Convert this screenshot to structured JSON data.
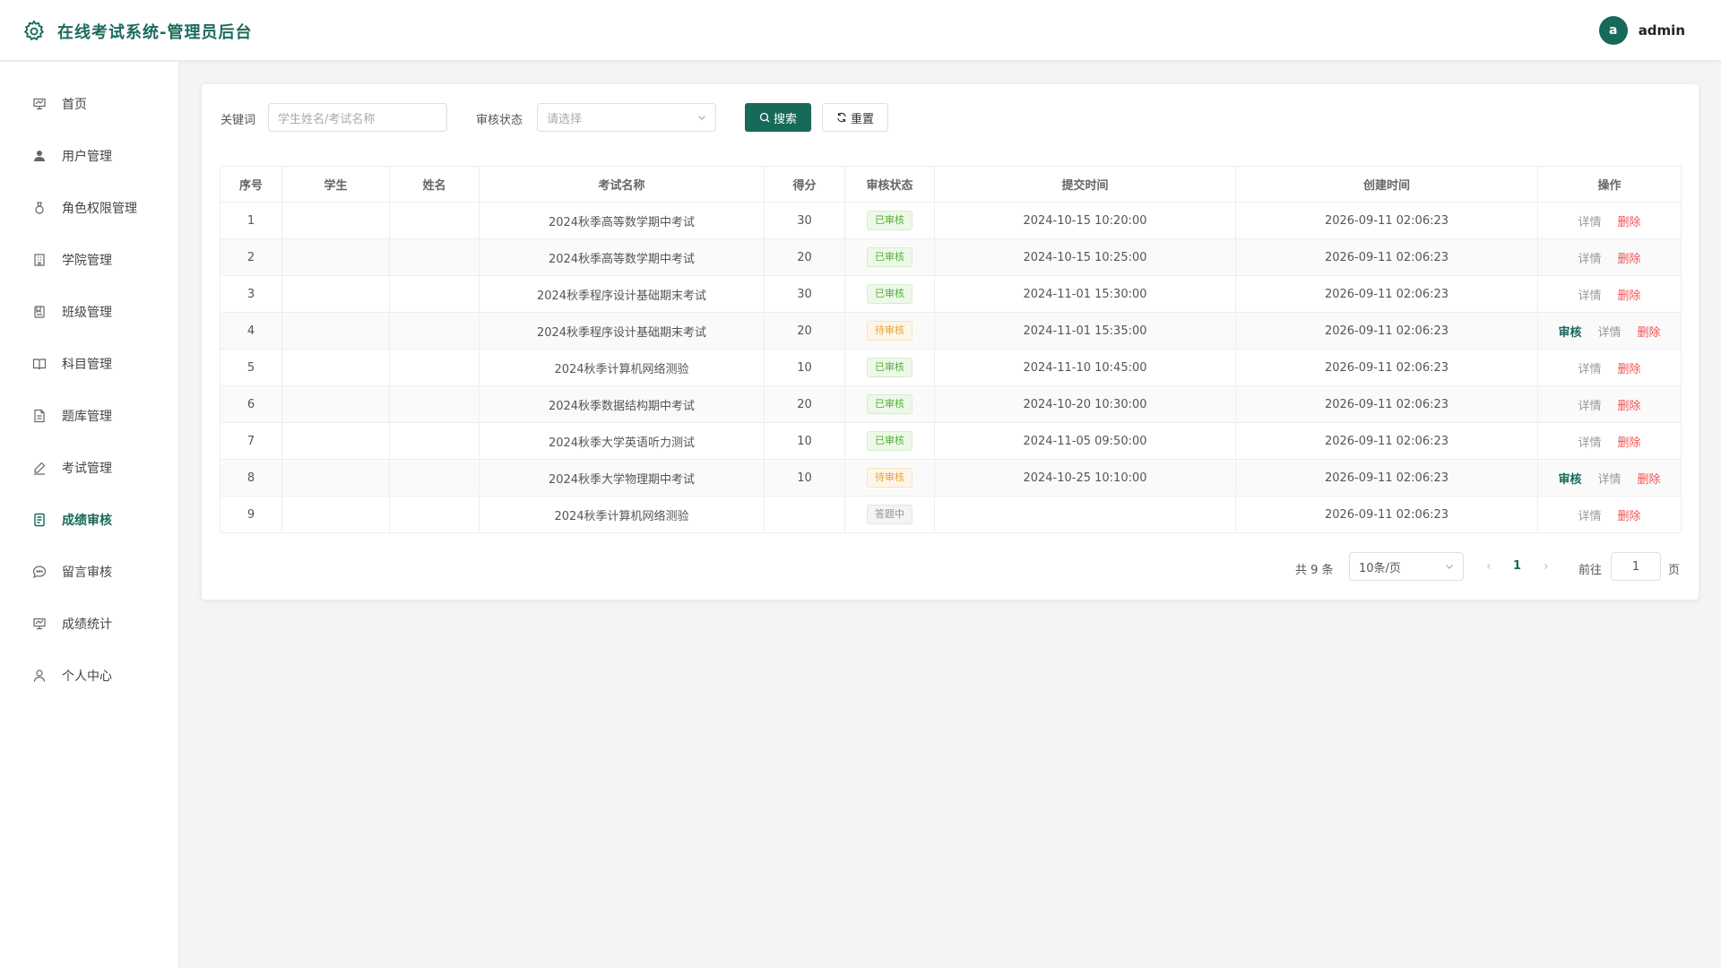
{
  "header": {
    "title": "在线考试系统-管理员后台",
    "avatar_letter": "a",
    "username": "admin"
  },
  "sidebar": {
    "items": [
      {
        "label": "首页",
        "icon": "dashboard-icon"
      },
      {
        "label": "用户管理",
        "icon": "user-icon"
      },
      {
        "label": "角色权限管理",
        "icon": "role-icon"
      },
      {
        "label": "学院管理",
        "icon": "building-icon"
      },
      {
        "label": "班级管理",
        "icon": "class-icon"
      },
      {
        "label": "科目管理",
        "icon": "book-icon"
      },
      {
        "label": "题库管理",
        "icon": "document-icon"
      },
      {
        "label": "考试管理",
        "icon": "edit-icon"
      },
      {
        "label": "成绩审核",
        "icon": "score-icon",
        "active": true
      },
      {
        "label": "留言审核",
        "icon": "message-icon"
      },
      {
        "label": "成绩统计",
        "icon": "chart-icon"
      },
      {
        "label": "个人中心",
        "icon": "person-icon"
      }
    ]
  },
  "filters": {
    "keyword_label": "关键词",
    "keyword_placeholder": "学生姓名/考试名称",
    "status_label": "审核状态",
    "status_placeholder": "请选择",
    "search_label": "搜索",
    "reset_label": "重置"
  },
  "table": {
    "columns": [
      "序号",
      "学生",
      "姓名",
      "考试名称",
      "得分",
      "审核状态",
      "提交时间",
      "创建时间",
      "操作"
    ],
    "rows": [
      {
        "no": "1",
        "student": "",
        "name": "",
        "exam": "2024秋季高等数学期中考试",
        "score": "30",
        "status": "已审核",
        "submit_time": "2024-10-15 10:20:00",
        "create_time": "2026-09-11 02:06:23"
      },
      {
        "no": "2",
        "student": "",
        "name": "",
        "exam": "2024秋季高等数学期中考试",
        "score": "20",
        "status": "已审核",
        "submit_time": "2024-10-15 10:25:00",
        "create_time": "2026-09-11 02:06:23"
      },
      {
        "no": "3",
        "student": "",
        "name": "",
        "exam": "2024秋季程序设计基础期末考试",
        "score": "30",
        "status": "已审核",
        "submit_time": "2024-11-01 15:30:00",
        "create_time": "2026-09-11 02:06:23"
      },
      {
        "no": "4",
        "student": "",
        "name": "",
        "exam": "2024秋季程序设计基础期末考试",
        "score": "20",
        "status": "待审核",
        "submit_time": "2024-11-01 15:35:00",
        "create_time": "2026-09-11 02:06:23"
      },
      {
        "no": "5",
        "student": "",
        "name": "",
        "exam": "2024秋季计算机网络测验",
        "score": "10",
        "status": "已审核",
        "submit_time": "2024-11-10 10:45:00",
        "create_time": "2026-09-11 02:06:23"
      },
      {
        "no": "6",
        "student": "",
        "name": "",
        "exam": "2024秋季数据结构期中考试",
        "score": "20",
        "status": "已审核",
        "submit_time": "2024-10-20 10:30:00",
        "create_time": "2026-09-11 02:06:23"
      },
      {
        "no": "7",
        "student": "",
        "name": "",
        "exam": "2024秋季大学英语听力测试",
        "score": "10",
        "status": "已审核",
        "submit_time": "2024-11-05 09:50:00",
        "create_time": "2026-09-11 02:06:23"
      },
      {
        "no": "8",
        "student": "",
        "name": "",
        "exam": "2024秋季大学物理期中考试",
        "score": "10",
        "status": "待审核",
        "submit_time": "2024-10-25 10:10:00",
        "create_time": "2026-09-11 02:06:23"
      },
      {
        "no": "9",
        "student": "",
        "name": "",
        "exam": "2024秋季计算机网络测验",
        "score": "",
        "status": "答题中",
        "submit_time": "",
        "create_time": "2026-09-11 02:06:23"
      }
    ],
    "actions": {
      "review": "审核",
      "detail": "详情",
      "delete": "删除"
    }
  },
  "pagination": {
    "total": "共 9 条",
    "page_size": "10条/页",
    "current_page": "1",
    "goto_label": "前往",
    "goto_value": "1",
    "page_unit": "页"
  },
  "colors": {
    "accent": "#17695a",
    "approved": "#52b038",
    "pending": "#e8a23a",
    "in_progress": "#909399",
    "delete": "#f05454"
  }
}
